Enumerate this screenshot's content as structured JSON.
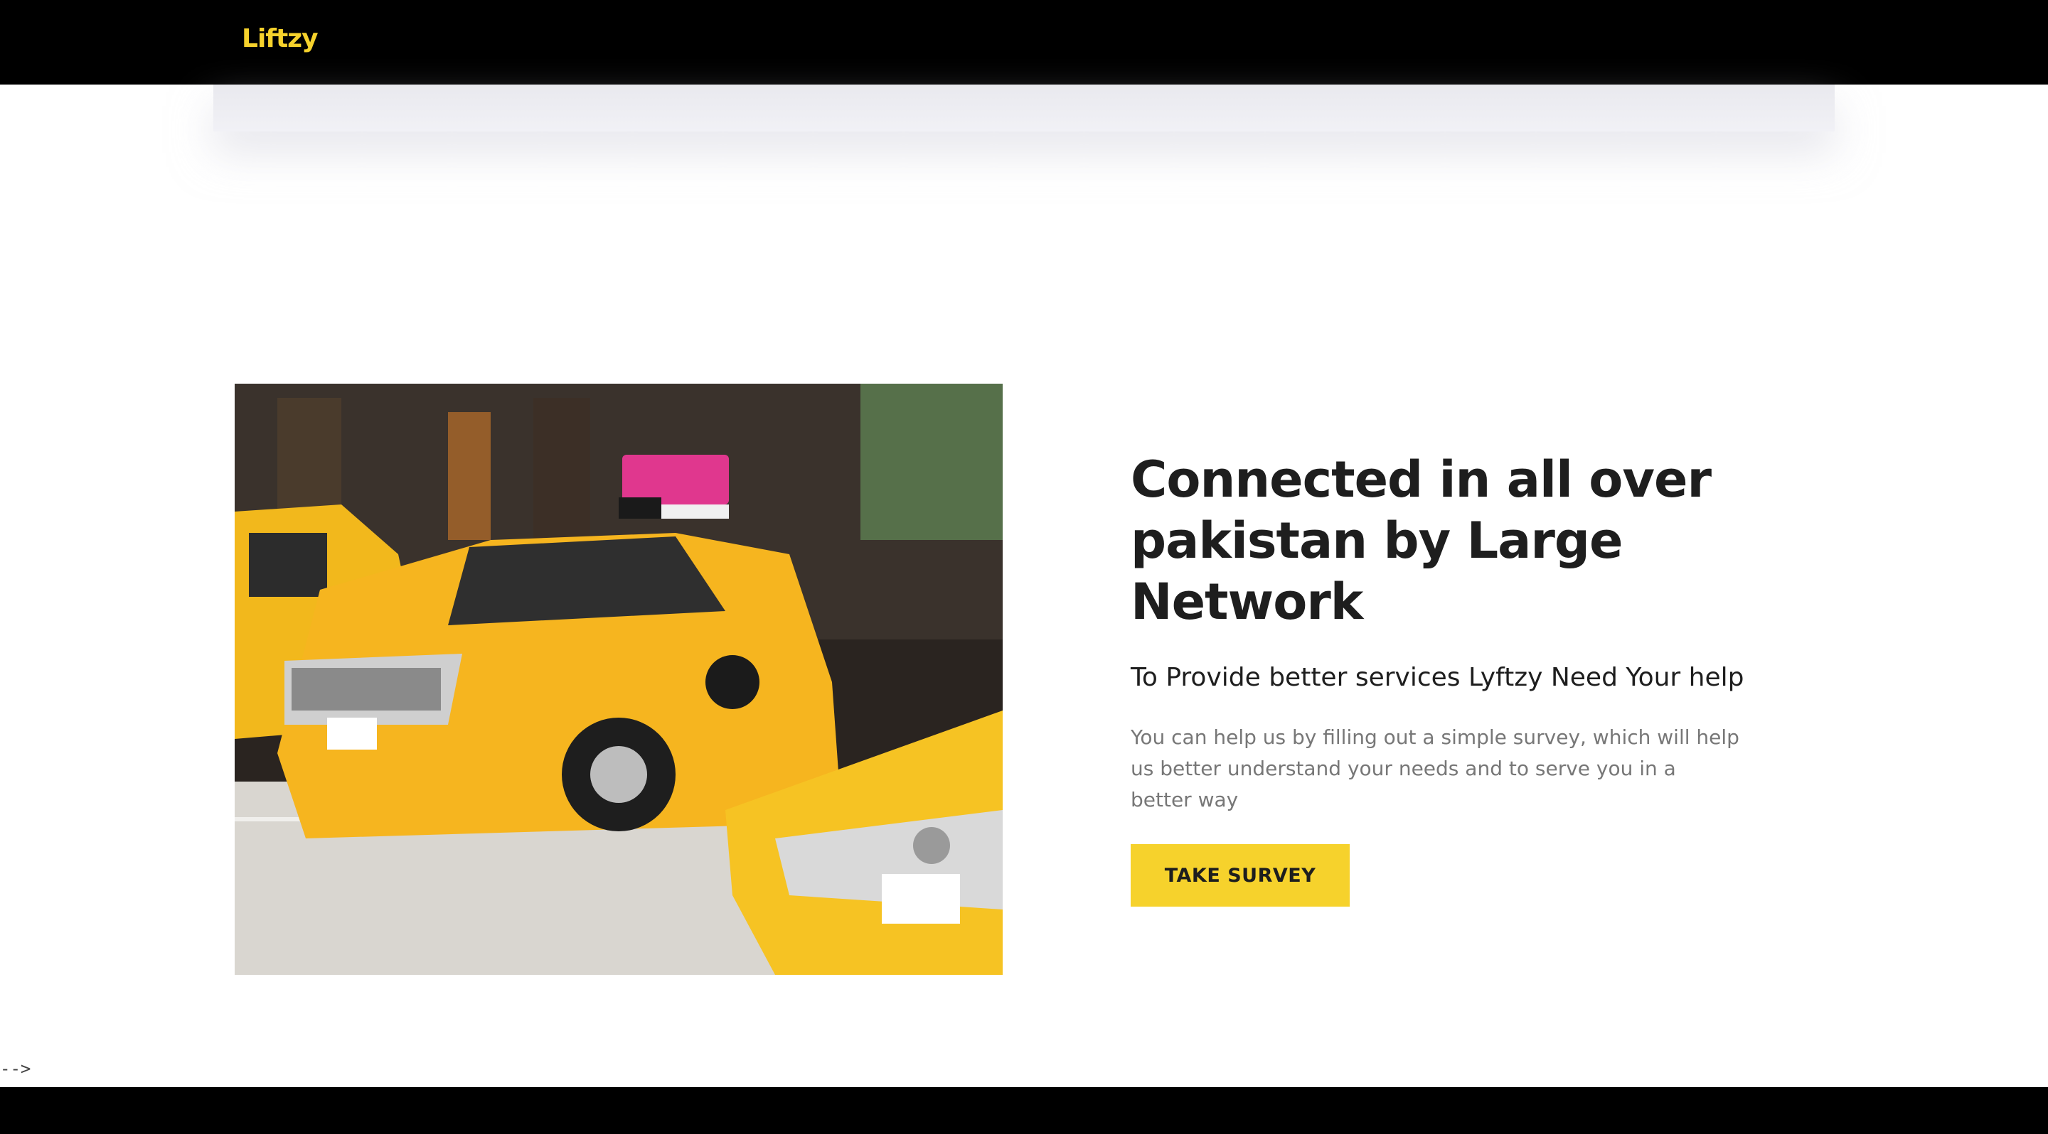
{
  "header": {
    "logo_text": "Liftzy"
  },
  "hero": {
    "image_description": "yellow-taxi-cabs-photo",
    "heading": "Connected in all over pakistan by Large Network",
    "subheading": "To Provide better services Lyftzy Need Your help",
    "body": "You can help us by filling out a simple survey, which will help us better understand your needs and to serve you in a better way",
    "cta_label": "TAKE SURVEY"
  },
  "stray_text": "-->",
  "colors": {
    "header_bg": "#000000",
    "brand_yellow": "#f6d22c",
    "heading_text": "#1e1e1e",
    "body_text": "#777777",
    "footer_bg": "#000000"
  }
}
